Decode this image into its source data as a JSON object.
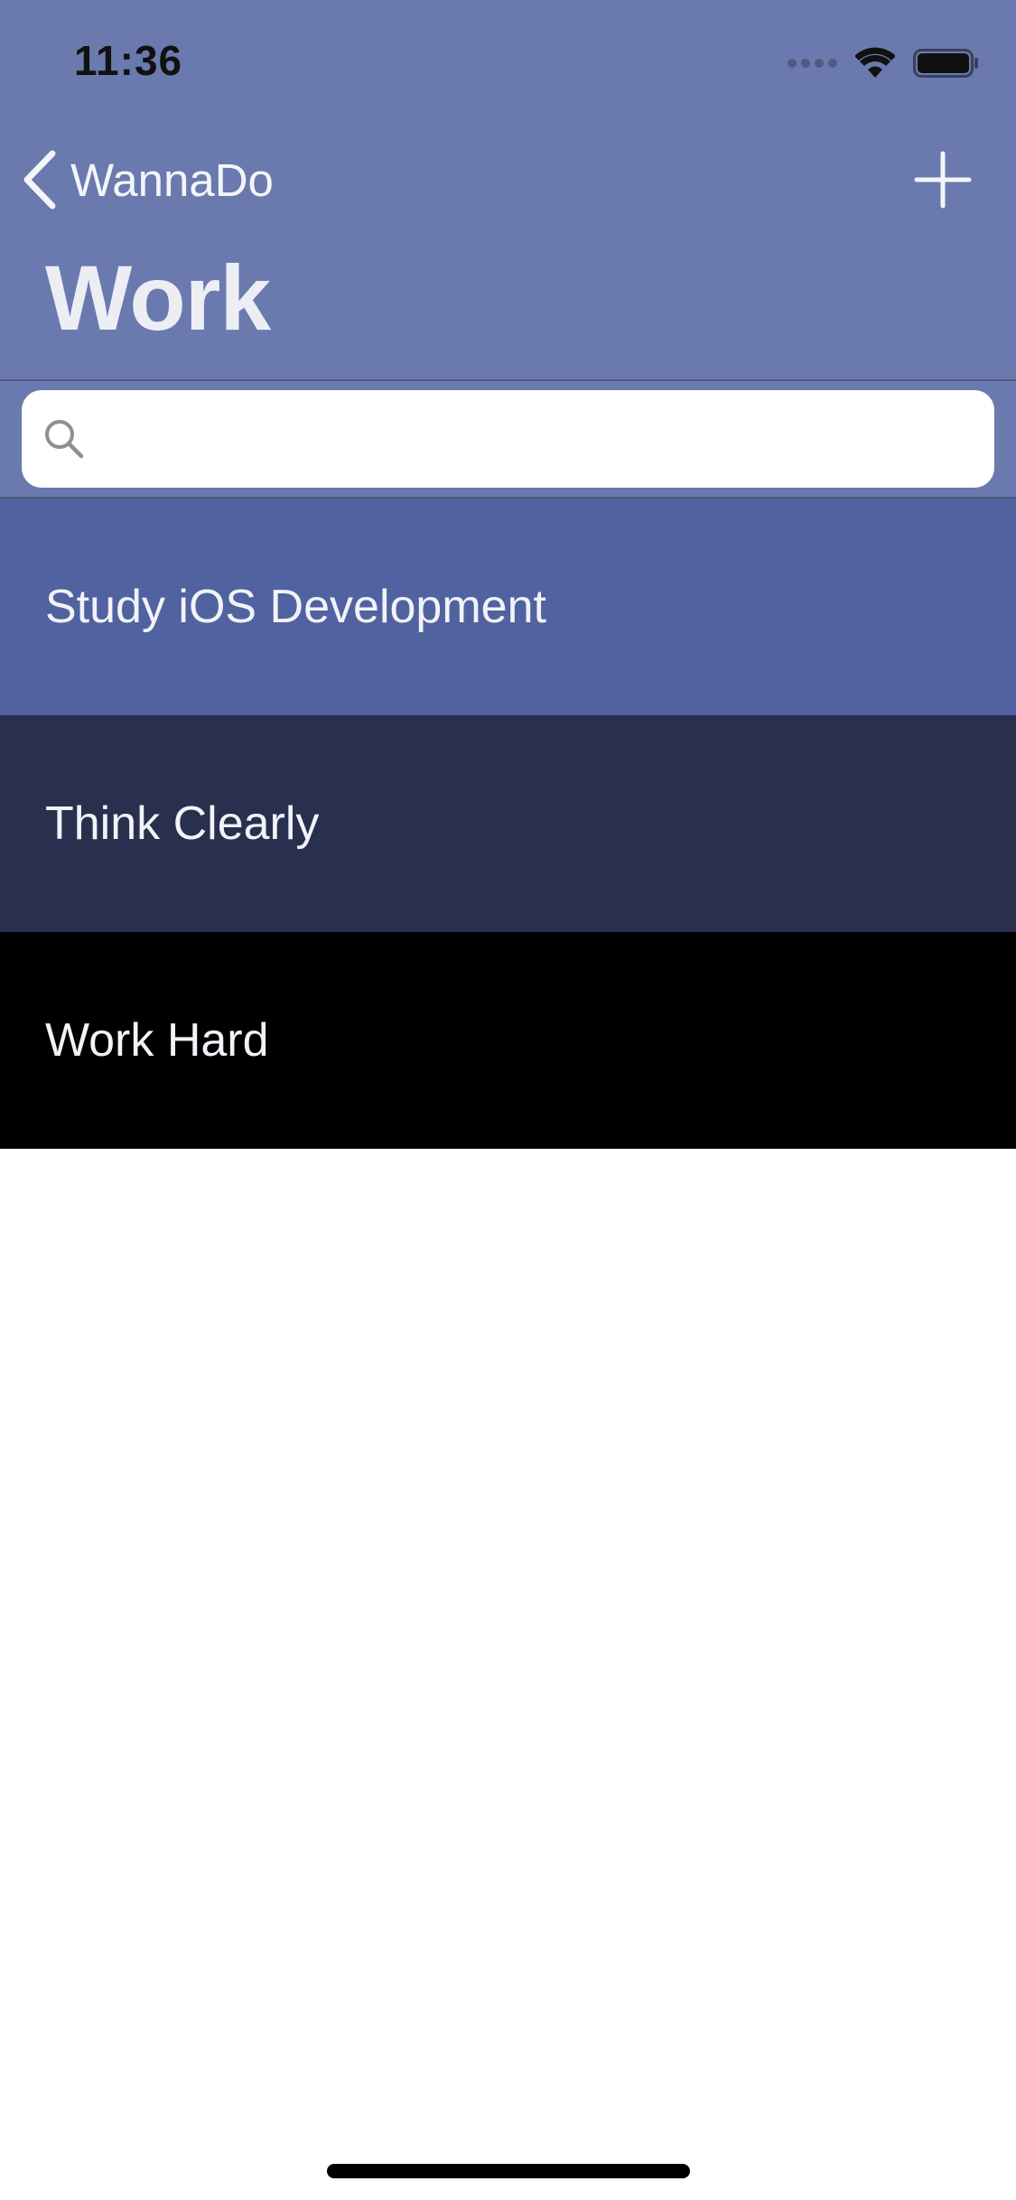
{
  "status_bar": {
    "time": "11:36"
  },
  "nav": {
    "back_label": "WannaDo",
    "title": "Work"
  },
  "search": {
    "placeholder": ""
  },
  "items": [
    {
      "label": "Study iOS Development",
      "color": "#5062a0"
    },
    {
      "label": "Think Clearly",
      "color": "#28304e"
    },
    {
      "label": "Work Hard",
      "color": "#000000"
    }
  ],
  "colors": {
    "header_bg": "#6a7aae",
    "text_light": "#f2f3f8"
  },
  "icons": {
    "back": "chevron-left-icon",
    "add": "plus-icon",
    "search": "magnifier-icon",
    "wifi": "wifi-icon",
    "battery": "battery-icon"
  }
}
